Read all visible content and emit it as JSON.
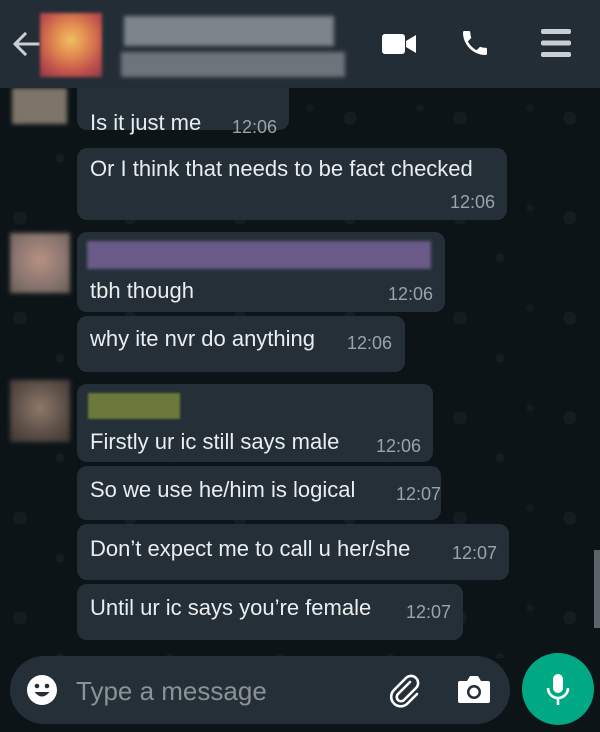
{
  "header": {
    "back_icon": "arrow-left-icon",
    "video_icon": "video-camera-icon",
    "call_icon": "phone-icon",
    "menu_icon": "menu-icon"
  },
  "messages": [
    {
      "text": "Is it just me",
      "time": "12:06"
    },
    {
      "text": "Or I think that needs to be fact checked",
      "time": "12:06"
    },
    {
      "text": "tbh though",
      "time": "12:06"
    },
    {
      "text": "why ite nvr do anything",
      "time": "12:06"
    },
    {
      "text": "Firstly ur ic still says male",
      "time": "12:06"
    },
    {
      "text": "So we use he/him is logical",
      "time": "12:07"
    },
    {
      "text": "Don’t expect me to call u her/she",
      "time": "12:07"
    },
    {
      "text": "Until ur ic says you’re female",
      "time": "12:07"
    }
  ],
  "composer": {
    "placeholder": "Type a message",
    "emoji_icon": "emoji-icon",
    "attach_icon": "paperclip-icon",
    "camera_icon": "camera-icon",
    "mic_icon": "microphone-icon"
  },
  "colors": {
    "header_bg": "#232d36",
    "chat_bg": "#0d1418",
    "bubble_bg": "#242f37",
    "accent": "#00a884",
    "sender_name_green": "#6b7a3a",
    "sender_name_purple": "#6a5a88"
  }
}
